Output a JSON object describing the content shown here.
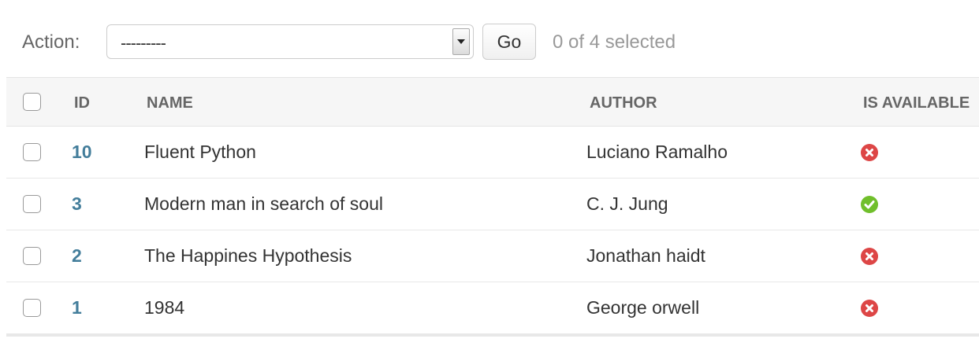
{
  "actions": {
    "label": "Action:",
    "select_value": "---------",
    "go_label": "Go",
    "selection_counter": "0 of 4 selected"
  },
  "table": {
    "columns": {
      "id": "ID",
      "name": "NAME",
      "author": "AUTHOR",
      "available": "IS AVAILABLE"
    },
    "rows": [
      {
        "id": "10",
        "name": "Fluent Python",
        "author": "Luciano Ramalho",
        "is_available": false
      },
      {
        "id": "3",
        "name": "Modern man in search of soul",
        "author": "C. J. Jung",
        "is_available": true
      },
      {
        "id": "2",
        "name": "The Happines Hypothesis",
        "author": "Jonathan haidt",
        "is_available": false
      },
      {
        "id": "1",
        "name": "1984",
        "author": "George orwell",
        "is_available": false
      }
    ]
  },
  "icons": {
    "available": "check-circle-icon",
    "unavailable": "x-circle-icon"
  },
  "colors": {
    "link": "#447e9b",
    "available": "#70bf2b",
    "unavailable": "#dd4646",
    "header_bg": "#f6f6f6"
  }
}
